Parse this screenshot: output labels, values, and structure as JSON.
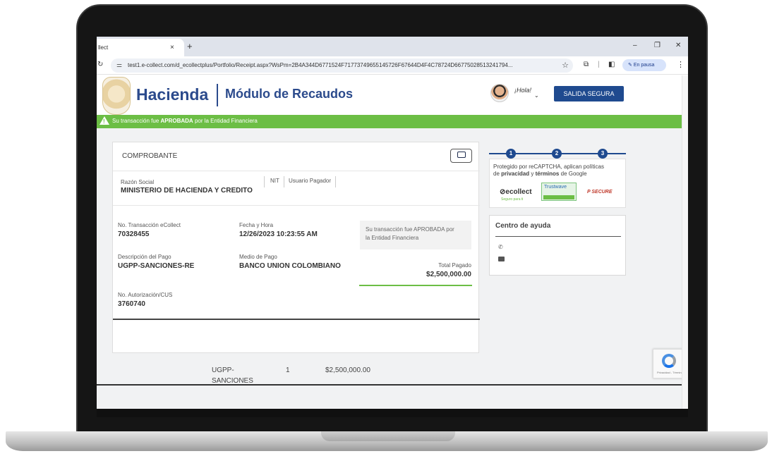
{
  "browser": {
    "tab_title": "llect",
    "tab_close": "×",
    "new_tab": "+",
    "url": "test1.e-collect.com/d_ecollectplus/Portfolio/Receipt.aspx?WsPm=2B4A344D6771524F71773749655145726F67644D4F4C78724D66775028513241794...",
    "paused_label": "En pausa",
    "window_controls": [
      "–",
      "❐",
      "✕"
    ]
  },
  "header": {
    "logo_text": "Hacienda",
    "module_title": "Módulo de Recaudos",
    "greeting": "¡Hola!",
    "logout_label": "SALIDA SEGURA"
  },
  "banner": {
    "prefix": "Su transacción fue ",
    "status": "APROBADA",
    "suffix": " por la Entidad Financiera"
  },
  "receipt": {
    "title": "COMPROBANTE",
    "razon_social_label": "Razón Social",
    "razon_social_value": "MINISTERIO DE HACIENDA Y CREDITO",
    "nit_label": "NIT",
    "usuario_label": "Usuario Pagador",
    "transaccion_label": "No. Transacción eCollect",
    "transaccion_value": "70328455",
    "fecha_label": "Fecha y Hora",
    "fecha_value": "12/26/2023 10:23:55 AM",
    "status_text_1": "Su transacción fue APROBADA por",
    "status_text_2": "la Entidad Financiera",
    "descripcion_label": "Descripción del Pago",
    "descripcion_value": "UGPP-SANCIONES-RE",
    "medio_label": "Medio de Pago",
    "medio_value": "BANCO UNION COLOMBIANO",
    "total_label": "Total Pagado",
    "total_value": "$2,500,000.00",
    "autorizacion_label": "No. Autorización/CUS",
    "autorizacion_value": "3760740",
    "detail_rows": [
      {
        "desc_1": "UGPP-",
        "desc_2": "SANCIONES",
        "qty": "1",
        "amount": "$2,500,000.00"
      }
    ]
  },
  "sidebar": {
    "steps": [
      "1",
      "2",
      "3"
    ],
    "captcha_text_1": "Protegido por reCAPTCHA, aplican políticas",
    "captcha_text_2": "de ",
    "captcha_privacy": "privacidad",
    "captcha_and": " y ",
    "captcha_terms": "términos",
    "captcha_text_3": " de Google",
    "brand_ecollect": "ecollect",
    "brand_ecollect_sub": "Seguro para ti",
    "brand_trustwave": "Trustwave",
    "brand_psecure": "P SECURE",
    "help_title": "Centro de ayuda"
  },
  "recaptcha_badge": "Privacidad - Términos"
}
